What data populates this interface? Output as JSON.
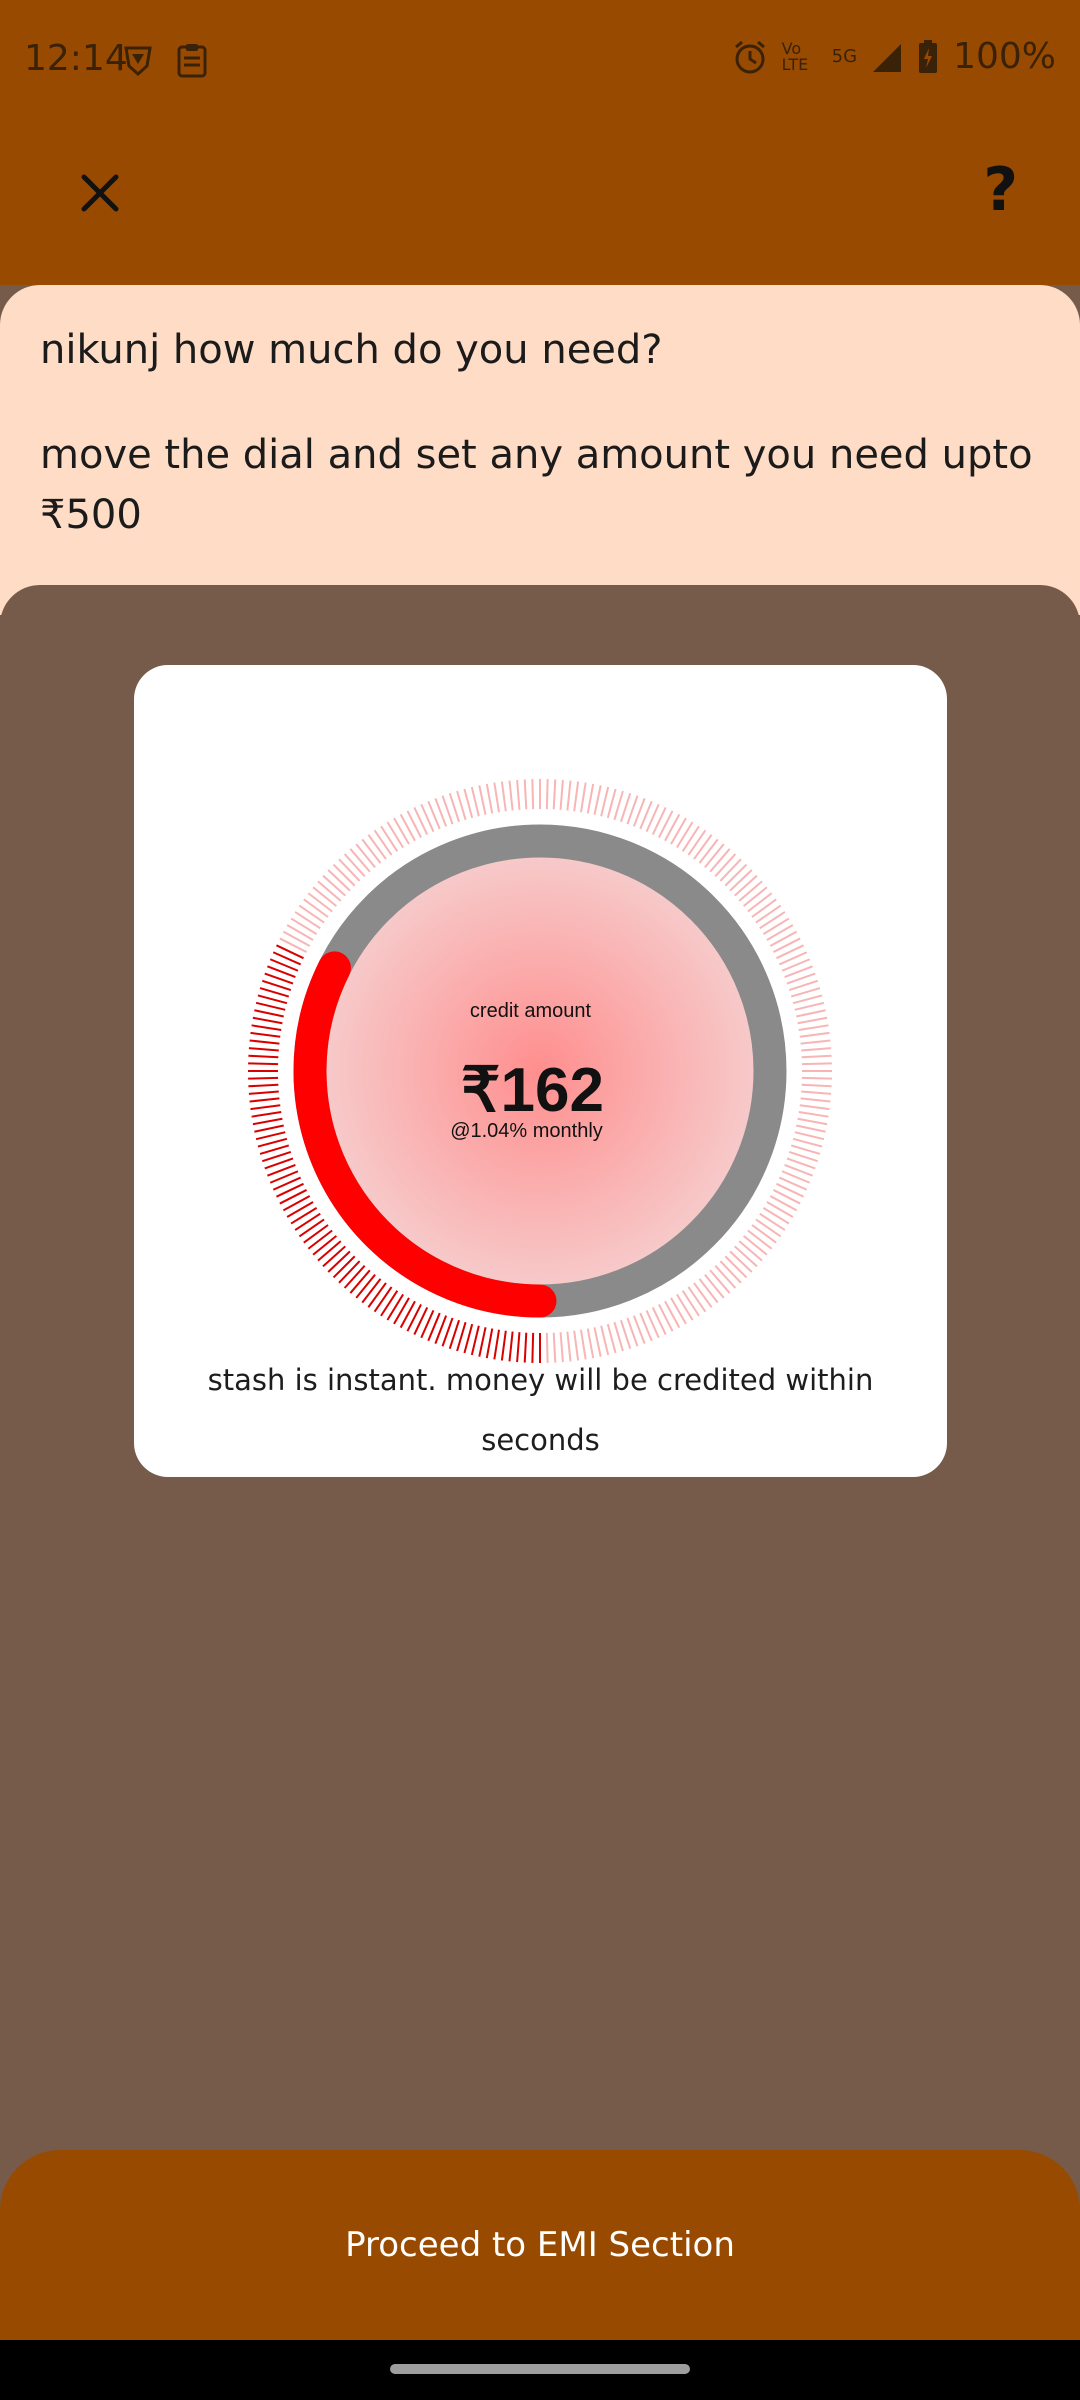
{
  "status_bar": {
    "time": "12:14",
    "battery": "100%",
    "network": "5G",
    "volte": "Vo LTE"
  },
  "header": {
    "close_icon": "close-icon",
    "help_label": "?"
  },
  "prompt": {
    "question": "nikunj how much do you need?",
    "instruction": "move the dial and set any amount you need upto ₹500"
  },
  "dial": {
    "label": "credit amount",
    "amount": "₹162",
    "rate": "@1.04% monthly",
    "max_amount": 500,
    "current_amount": 162,
    "accent_color": "#FF0000",
    "track_color": "#8A8A8A"
  },
  "note": "stash is instant. money will be credited within seconds",
  "cta": {
    "label": "Proceed to EMI Section"
  },
  "colors": {
    "brand": "#984B00",
    "peach": "#FFDCC5",
    "backdrop": "#765B4B"
  }
}
